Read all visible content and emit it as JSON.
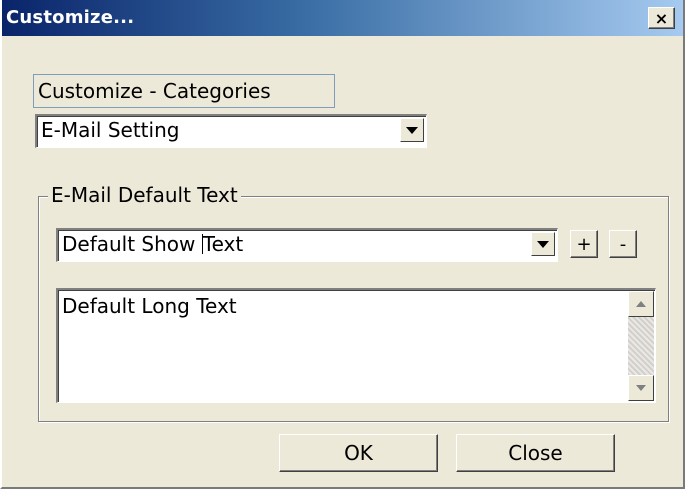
{
  "window": {
    "title": "Customize...",
    "close_glyph": "×"
  },
  "categories": {
    "label": "Customize - Categories",
    "selected": "E-Mail Setting"
  },
  "group": {
    "legend": "E-Mail Default Text",
    "show_text_value_before": "Default Show ",
    "show_text_value_after": "Text",
    "add_label": "+",
    "remove_label": "-",
    "long_text_value": "Default Long Text"
  },
  "buttons": {
    "ok_label": "OK",
    "close_label": "Close"
  }
}
